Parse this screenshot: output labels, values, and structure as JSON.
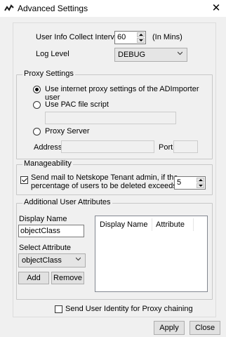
{
  "window": {
    "title": "Advanced Settings",
    "close_glyph": "✕"
  },
  "collection": {
    "interval_label": "User Info Collect Interval",
    "interval_value": "60",
    "interval_unit": "(In Mins)",
    "log_level_label": "Log Level",
    "log_level_value": "DEBUG"
  },
  "proxy": {
    "group_label": "Proxy Settings",
    "option_internet": "Use internet proxy settings of the ADImporter user",
    "option_pac": "Use PAC file script",
    "option_server": "Proxy Server",
    "address_label": "Address",
    "port_label": "Port"
  },
  "manageability": {
    "group_label": "Manageability",
    "mail_label_line1": "Send mail to Netskope Tenant admin, if the",
    "mail_label_line2": "percentage of users to be deleted exceeds",
    "mail_value": "5"
  },
  "attributes": {
    "group_label": "Additional User Attributes",
    "display_name_label": "Display Name",
    "display_name_value": "objectClass",
    "select_label": "Select Attribute",
    "select_value": "objectClass",
    "add_label": "Add",
    "remove_label": "Remove",
    "columns": [
      "Display Name",
      "Attribute"
    ]
  },
  "proxy_chaining_label": "Send User Identity for Proxy chaining",
  "footer": {
    "apply_label": "Apply",
    "close_label": "Close"
  },
  "colors": {
    "app_icon": "#1a1a1a"
  }
}
